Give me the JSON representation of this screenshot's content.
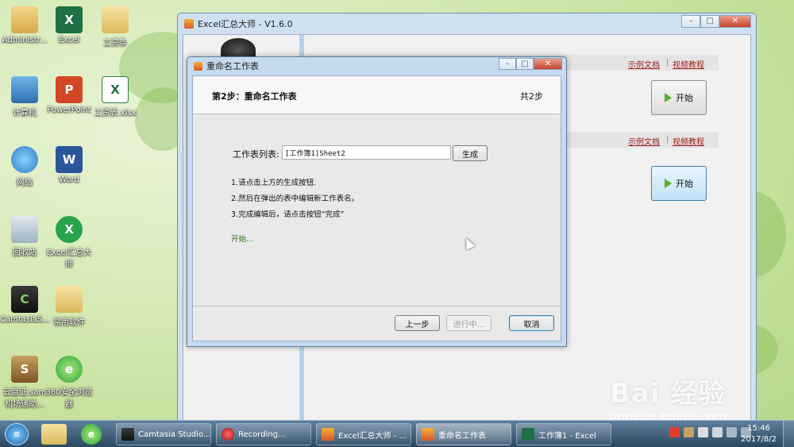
{
  "desktop": {
    "icons": [
      {
        "label": "Administr...",
        "icon": "user-folder-icon"
      },
      {
        "label": "Excel",
        "icon": "excel-icon"
      },
      {
        "label": "工资条",
        "icon": "folder-icon"
      },
      {
        "label": "计算机",
        "icon": "computer-icon"
      },
      {
        "label": "PowerPoint",
        "icon": "powerpoint-icon"
      },
      {
        "label": "工资表.xlsx",
        "icon": "xlsx-file-icon"
      },
      {
        "label": "网络",
        "icon": "network-icon"
      },
      {
        "label": "Word",
        "icon": "word-icon"
      },
      {
        "label": "回收站",
        "icon": "recycle-bin-icon"
      },
      {
        "label": "Excel汇总大师",
        "icon": "excel-summary-icon"
      },
      {
        "label": "CamtasiaS...",
        "icon": "camtasia-icon"
      },
      {
        "label": "常用软件",
        "icon": "folder-icon"
      },
      {
        "label": "云盘证.sam 机场通助...",
        "icon": "cloud-app-icon"
      },
      {
        "label": "360安全浏览器",
        "icon": "browser-icon"
      }
    ]
  },
  "main_window": {
    "title": "Excel汇总大师 - V1.6.0",
    "controls": {
      "minimize": "–",
      "maximize": "□",
      "close": "✕"
    },
    "section1": {
      "link1": "示例文档",
      "sep": "|",
      "link2": "视频教程",
      "start_label": "开始"
    },
    "section2": {
      "link1": "示例文档",
      "sep": "|",
      "link2": "视频教程",
      "start_label": "开始"
    }
  },
  "dialog": {
    "title": "重命名工作表",
    "controls": {
      "minimize": "–",
      "maximize": "□",
      "close": "✕"
    },
    "step_title": "第2步：重命名工作表",
    "step_count": "共2步",
    "sheet_list_label": "工作表列表:",
    "sheet_list_value": "[工作簿1]Sheet2",
    "generate_button": "生成",
    "instructions": [
      "1.请点击上方的生成按钮.",
      "2.然后在弹出的表中编辑新工作表名。",
      "3.完成编辑后，请点击按钮“完成”"
    ],
    "status": "开始...",
    "prev_button": "上一步",
    "progress_button": "进行中...",
    "cancel_button": "取消"
  },
  "taskbar": {
    "tasks": [
      {
        "label": "Camtasia Studio...",
        "icon": "camtasia-icon"
      },
      {
        "label": "Recording...",
        "icon": "recording-icon"
      },
      {
        "label": "Excel汇总大师 - ...",
        "icon": "excel-summary-icon"
      },
      {
        "label": "重命名工作表",
        "icon": "dialog-icon"
      },
      {
        "label": "工作簿1 - Excel",
        "icon": "excel-icon"
      }
    ],
    "clock_time": "15:46",
    "clock_date": "2017/8/2"
  },
  "watermark": {
    "logo": "Bai 经验",
    "url": "jingyan.baidu.com"
  },
  "colors": {
    "link": "#a0221d",
    "status_green": "#2e6f15",
    "accent_blue": "#3c7fb1"
  }
}
